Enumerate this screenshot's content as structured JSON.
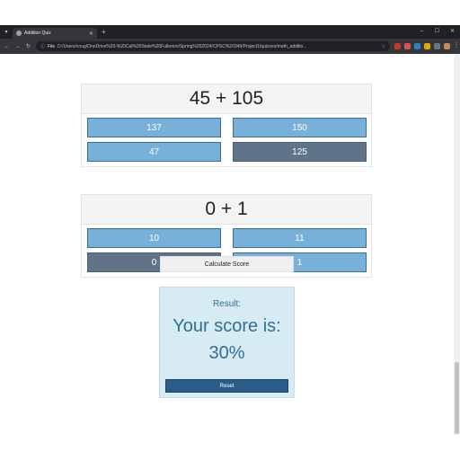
{
  "browser": {
    "tab_title": "Addition Quiz",
    "address_chip": "File",
    "url": "D:/Users/cnug/OneDrive%20-%20Cal%20State%20Fullerton/Spring%202024/CPSC%20349/Project1/quizzes/math_additio...",
    "window_controls": {
      "minimize": "–",
      "maximize": "☐",
      "close": "✕"
    }
  },
  "questions": [
    {
      "prompt": "45 + 105",
      "options": [
        {
          "label": "137",
          "selected": false
        },
        {
          "label": "150",
          "selected": false
        },
        {
          "label": "47",
          "selected": false
        },
        {
          "label": "125",
          "selected": true
        }
      ]
    },
    {
      "prompt": "0 + 1",
      "options": [
        {
          "label": "10",
          "selected": false
        },
        {
          "label": "11",
          "selected": false
        },
        {
          "label": "0",
          "selected": true
        },
        {
          "label": "1",
          "selected": false
        }
      ]
    }
  ],
  "actions": {
    "calculate_label": "Calculate Score",
    "reset_label": "Reset"
  },
  "result": {
    "heading": "Result:",
    "score_text": "Your score is:",
    "score_value": "30%"
  },
  "colors": {
    "option_default": "#77b0d8",
    "option_selected": "#5f7489",
    "result_bg": "#d7ebf5",
    "result_text": "#2f6f93",
    "reset_bg": "#2a5d88"
  },
  "icons": [
    "tab-menu-icon",
    "page-favicon-icon",
    "close-tab-icon",
    "new-tab-icon",
    "back-icon",
    "forward-icon",
    "reload-icon",
    "info-icon",
    "star-icon",
    "extension-icon",
    "profile-avatar",
    "kebab-menu-icon"
  ]
}
